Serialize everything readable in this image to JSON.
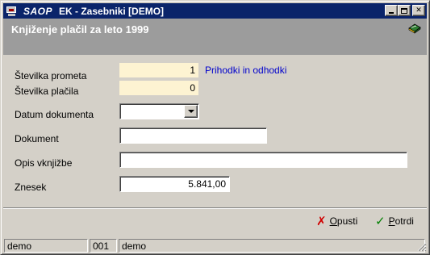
{
  "window": {
    "brand": "SAOP",
    "title": "EK - Zasebniki [DEMO]",
    "icon": "computer-monitor-icon",
    "controls": [
      "minimize",
      "maximize",
      "close"
    ]
  },
  "header": {
    "title": "Knjiženje plačil za leto 1999",
    "icon": "book-icon"
  },
  "form": {
    "stevilka_prometa": {
      "label": "Številka prometa",
      "value": "1",
      "note": "Prihodki in odhodki"
    },
    "stevilka_placila": {
      "label": "Številka plačila",
      "value": "0"
    },
    "datum_dokumenta": {
      "label": "Datum dokumenta",
      "value": ""
    },
    "dokument": {
      "label": "Dokument",
      "value": ""
    },
    "opis_vknjizbe": {
      "label": "Opis vknjižbe",
      "value": ""
    },
    "znesek": {
      "label": "Znesek",
      "value": "5.841,00"
    }
  },
  "actions": {
    "cancel": {
      "mnemonic": "O",
      "rest": "pusti",
      "icon": "x-icon"
    },
    "confirm": {
      "mnemonic": "P",
      "rest": "otrdi",
      "icon": "checkmark-icon"
    }
  },
  "statusbar": {
    "user": "demo",
    "code": "001",
    "company": "demo"
  },
  "colors": {
    "titlebar": "#0a246a",
    "header_band": "#9c9c9c",
    "readonly_field": "#fdf3d2",
    "link_text": "#0000cc"
  }
}
